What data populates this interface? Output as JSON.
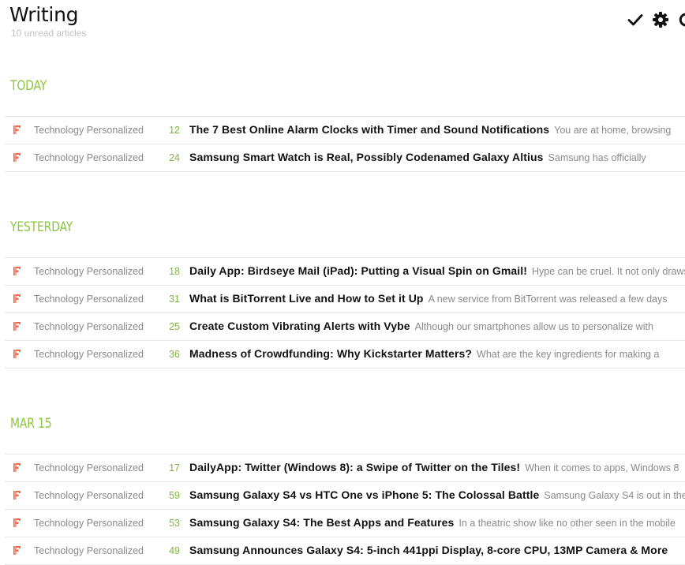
{
  "header": {
    "title": "Writing",
    "unread": "10 unread articles"
  },
  "toolbar": {
    "icons": [
      "checkmark-icon",
      "gear-icon",
      "refresh-icon"
    ]
  },
  "colors": {
    "accent": "#8cc63f",
    "count": "#7fb643",
    "feed_icon": "#f26a4b"
  },
  "sections": [
    {
      "heading": "TODAY",
      "articles": [
        {
          "feed": "Technology Personalized",
          "count": "12",
          "title": "The 7 Best Online Alarm Clocks with Timer and Sound Notifications",
          "snippet": "You are at home, browsing"
        },
        {
          "feed": "Technology Personalized",
          "count": "24",
          "title": "Samsung Smart Watch is Real, Possibly Codenamed Galaxy Altius",
          "snippet": "Samsung has officially"
        }
      ]
    },
    {
      "heading": "YESTERDAY",
      "articles": [
        {
          "feed": "Technology Personalized",
          "count": "18",
          "title": "Daily App: Birdseye Mail (iPad): Putting a Visual Spin on Gmail!",
          "snippet": "Hype can be cruel. It not only draws"
        },
        {
          "feed": "Technology Personalized",
          "count": "31",
          "title": "What is BitTorrent Live and How to Set it Up",
          "snippet": "A new service from BitTorrent was released a few days"
        },
        {
          "feed": "Technology Personalized",
          "count": "25",
          "title": "Create Custom Vibrating Alerts with Vybe",
          "snippet": "Although our smartphones allow us to personalize with"
        },
        {
          "feed": "Technology Personalized",
          "count": "36",
          "title": "Madness of Crowdfunding: Why Kickstarter Matters?",
          "snippet": "What are the key ingredients for making a"
        }
      ]
    },
    {
      "heading": "MAR 15",
      "articles": [
        {
          "feed": "Technology Personalized",
          "count": "17",
          "title": "DailyApp: Twitter (Windows 8): a Swipe of Twitter on the Tiles!",
          "snippet": "When it comes to apps, Windows 8"
        },
        {
          "feed": "Technology Personalized",
          "count": "59",
          "title": "Samsung Galaxy S4 vs HTC One vs iPhone 5: The Colossal Battle",
          "snippet": "Samsung Galaxy S4 is out in the"
        },
        {
          "feed": "Technology Personalized",
          "count": "53",
          "title": "Samsung Galaxy S4: The Best Apps and Features",
          "snippet": "In a theatric show like no other seen in the mobile"
        },
        {
          "feed": "Technology Personalized",
          "count": "49",
          "title": "Samsung Announces Galaxy S4: 5-inch 441ppi Display, 8-core CPU, 13MP Camera & More",
          "snippet": ""
        }
      ]
    }
  ]
}
